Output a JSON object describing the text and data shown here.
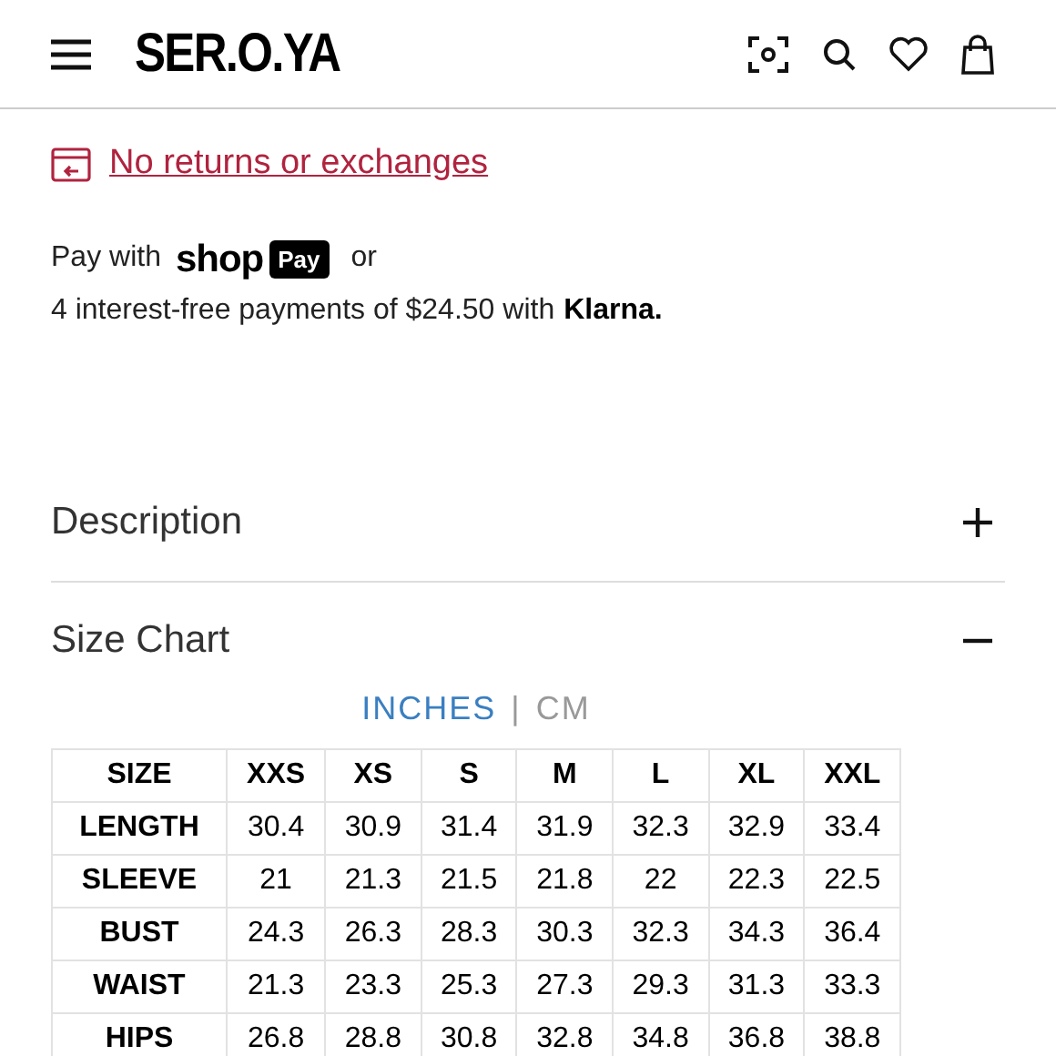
{
  "header": {
    "logo": "SER.O.YA"
  },
  "returns_link": "No returns or exchanges",
  "payment": {
    "prefix": "Pay with",
    "shop": "shop",
    "pay": "Pay",
    "suffix": "or",
    "installments": "4 interest-free payments of $24.50 with",
    "klarna": "Klarna."
  },
  "accordion": [
    {
      "title": "Description",
      "expanded": false
    },
    {
      "title": "Size Chart",
      "expanded": true
    }
  ],
  "units": [
    {
      "label": "INCHES",
      "selected": true
    },
    {
      "label": "CM",
      "selected": false
    }
  ],
  "unit_separator": "|",
  "table": {
    "columns": [
      "SIZE",
      "XXS",
      "XS",
      "S",
      "M",
      "L",
      "XL",
      "XXL"
    ],
    "rows": [
      [
        "LENGTH",
        "30.4",
        "30.9",
        "31.4",
        "31.9",
        "32.3",
        "32.9",
        "33.4"
      ],
      [
        "SLEEVE",
        "21",
        "21.3",
        "21.5",
        "21.8",
        "22",
        "22.3",
        "22.5"
      ],
      [
        "BUST",
        "24.3",
        "26.3",
        "28.3",
        "30.3",
        "32.3",
        "34.3",
        "36.4"
      ],
      [
        "WAIST",
        "21.3",
        "23.3",
        "25.3",
        "27.3",
        "29.3",
        "31.3",
        "33.3"
      ],
      [
        "HIPS",
        "26.8",
        "28.8",
        "30.8",
        "32.8",
        "34.8",
        "36.8",
        "38.8"
      ]
    ]
  }
}
